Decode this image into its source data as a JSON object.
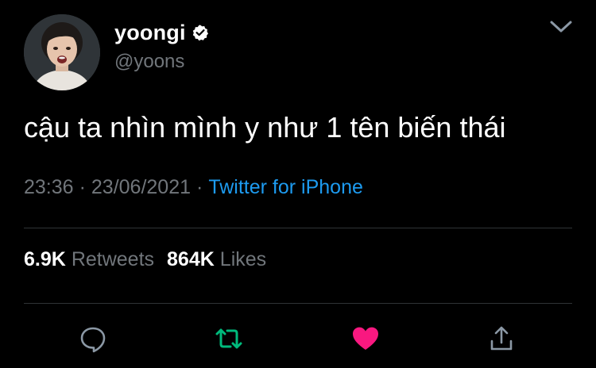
{
  "author": {
    "display_name": "yoongi",
    "handle": "@yoons",
    "verified": true
  },
  "tweet": {
    "text": "cậu ta nhìn mình y như 1 tên biến thái",
    "time": "23:36",
    "date": "23/06/2021",
    "separator": "·",
    "source": "Twitter for iPhone"
  },
  "stats": {
    "retweets_count": "6.9K",
    "retweets_label": "Retweets",
    "likes_count": "864K",
    "likes_label": "Likes"
  },
  "actions": {
    "reply_icon": "reply-icon",
    "retweet_icon": "retweet-icon",
    "like_icon": "like-icon",
    "share_icon": "share-icon"
  },
  "colors": {
    "background": "#000000",
    "text_primary": "#ffffff",
    "text_secondary": "#71767b",
    "link": "#1d9bf0",
    "retweet_active": "#00ba7c",
    "like_active": "#f91880",
    "divider": "#2f3336"
  }
}
